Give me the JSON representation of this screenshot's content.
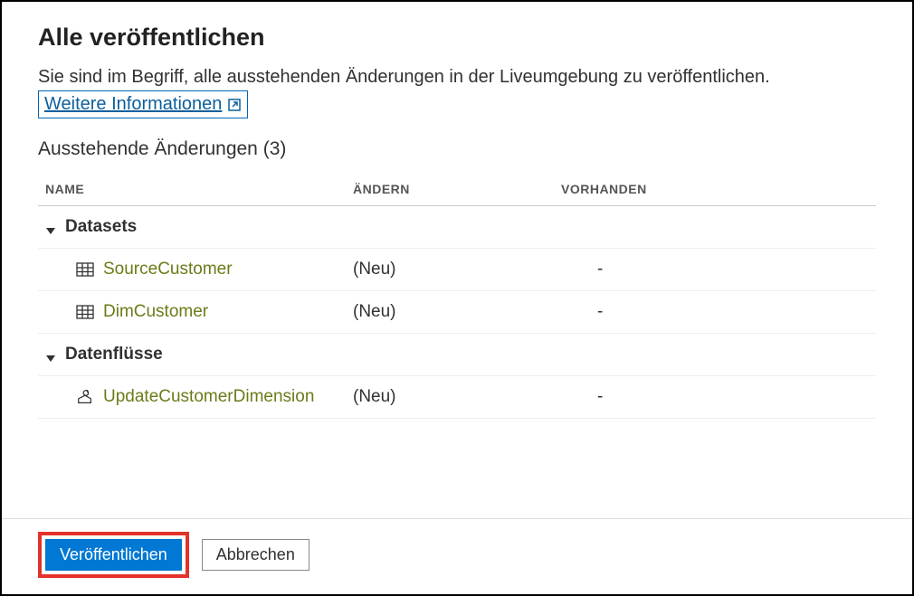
{
  "dialog": {
    "title": "Alle veröffentlichen",
    "description_part1": "Sie sind im Begriff, alle ausstehenden Änderungen in der Liveumgebung zu veröffentlichen. ",
    "more_info_label": "Weitere Informationen",
    "section_title": "Ausstehende Änderungen (3)"
  },
  "columns": {
    "name": "NAME",
    "change": "ÄNDERN",
    "exist": "VORHANDEN"
  },
  "groups": [
    {
      "label": "Datasets",
      "items": [
        {
          "icon": "dataset",
          "name": "SourceCustomer",
          "change": "(Neu)",
          "exist": "-"
        },
        {
          "icon": "dataset",
          "name": "DimCustomer",
          "change": "(Neu)",
          "exist": "-"
        }
      ]
    },
    {
      "label": "Datenflüsse",
      "items": [
        {
          "icon": "dataflow",
          "name": "UpdateCustomerDimension",
          "change": "(Neu)",
          "exist": "-"
        }
      ]
    }
  ],
  "buttons": {
    "publish": "Veröffentlichen",
    "cancel": "Abbrechen"
  }
}
